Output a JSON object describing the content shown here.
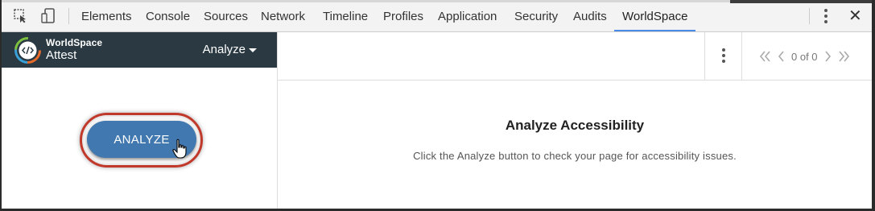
{
  "devtools": {
    "tabs": [
      {
        "label": "Elements"
      },
      {
        "label": "Console"
      },
      {
        "label": "Sources"
      },
      {
        "label": "Network"
      },
      {
        "label": "Timeline"
      },
      {
        "label": "Profiles"
      },
      {
        "label": "Application"
      },
      {
        "label": "Security"
      },
      {
        "label": "Audits"
      },
      {
        "label": "WorldSpace",
        "active": true
      }
    ],
    "accent_color": "#4a8ce8"
  },
  "brand": {
    "name_top": "WorldSpace",
    "name_bottom": "Attest",
    "menu_label": "Analyze",
    "bar_color": "#2a3942"
  },
  "left": {
    "analyze_button": "ANALYZE",
    "button_color": "#4178b0",
    "highlight_color": "#c0392b"
  },
  "pager": {
    "count": "0 of 0"
  },
  "main": {
    "title": "Analyze Accessibility",
    "description": "Click the Analyze button to check your page for accessibility issues."
  }
}
